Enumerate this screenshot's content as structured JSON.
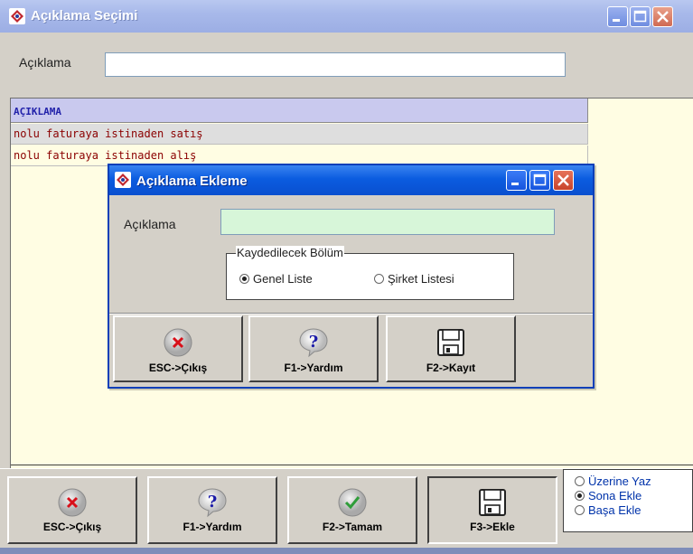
{
  "main_window": {
    "title": "Açıklama Seçimi",
    "filter": {
      "label": "Açıklama",
      "value": ""
    },
    "grid": {
      "header": "AÇIKLAMA",
      "rows": [
        "nolu faturaya istinaden satış",
        "nolu faturaya istinaden alış"
      ]
    },
    "buttons": {
      "exit": "ESC->Çıkış",
      "help": "F1->Yardım",
      "ok": "F2->Tamam",
      "add": "F3->Ekle"
    },
    "insert_mode": {
      "options": [
        "Üzerine Yaz",
        "Sona Ekle",
        "Başa Ekle"
      ],
      "selected": "Sona Ekle"
    }
  },
  "dialog": {
    "title": "Açıklama Ekleme",
    "field": {
      "label": "Açıklama",
      "value": ""
    },
    "group": {
      "legend": "Kaydedilecek Bölüm",
      "options": [
        "Genel Liste",
        "Şirket Listesi"
      ],
      "selected": "Genel Liste"
    },
    "buttons": {
      "exit": "ESC->Çıkış",
      "help": "F1->Yardım",
      "save": "F2->Kayıt"
    }
  },
  "colors": {
    "main_title_bg": "#a8b9ea",
    "dialog_title_bg": "#0b5ce0",
    "grid_header_bg": "#c9c9ee",
    "grid_text": "#8b0000",
    "dialog_input_bg": "#d7f6d9",
    "window_bg": "#d4d0c8"
  },
  "icons": {
    "app": "app-logo-icon",
    "minimize": "minimize-icon",
    "maximize": "maximize-icon",
    "close": "close-icon",
    "exit": "close-circle-icon",
    "help": "question-bubble-icon",
    "ok": "checkmark-circle-icon",
    "save": "floppy-disk-icon"
  }
}
